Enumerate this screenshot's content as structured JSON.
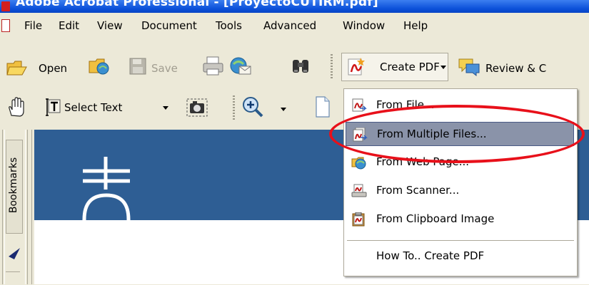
{
  "window": {
    "title": "Adobe Acrobat Professional - [ProyectoCUTIRM.pdf]"
  },
  "menubar": {
    "items": [
      "File",
      "Edit",
      "View",
      "Document",
      "Tools",
      "Advanced",
      "Window",
      "Help"
    ]
  },
  "toolbar1": {
    "open_label": "Open",
    "save_label": "Save",
    "create_pdf_label": "Create PDF",
    "review_label": "Review & C"
  },
  "toolbar2": {
    "select_text_label": "Select Text"
  },
  "left_panel": {
    "bookmarks_tab_label": "Bookmarks"
  },
  "dropdown": {
    "items": [
      {
        "label": "From File...",
        "icon": "from-file-icon",
        "highlighted": false
      },
      {
        "label": "From Multiple Files...",
        "icon": "from-multiple-files-icon",
        "highlighted": true
      },
      {
        "label": "From Web Page...",
        "icon": "from-web-page-icon",
        "highlighted": false
      },
      {
        "label": "From Scanner...",
        "icon": "from-scanner-icon",
        "highlighted": false
      },
      {
        "label": "From Clipboard Image",
        "icon": "from-clipboard-icon",
        "highlighted": false
      },
      {
        "label": "How To.. Create PDF",
        "icon": "",
        "highlighted": false
      }
    ]
  },
  "colors": {
    "titlebar": "#0a4fd8",
    "highlight": "#8a93a9",
    "annotation": "#e8101a",
    "document_header": "#2e5e94"
  }
}
